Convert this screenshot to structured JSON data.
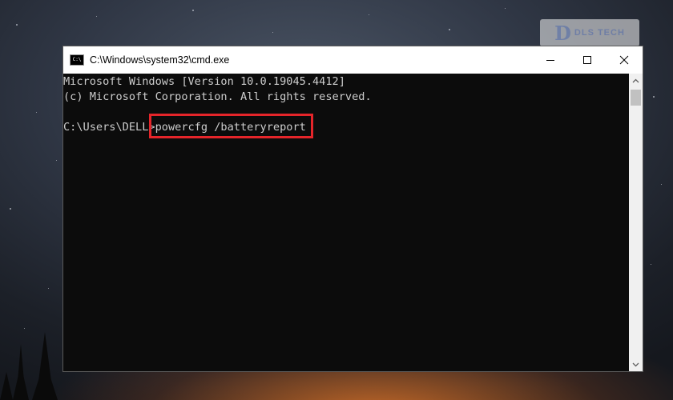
{
  "window": {
    "title": "C:\\Windows\\system32\\cmd.exe",
    "icon_label": "C:\\"
  },
  "console": {
    "line1": "Microsoft Windows [Version 10.0.19045.4412]",
    "line2": "(c) Microsoft Corporation. All rights reserved.",
    "prompt": "C:\\Users\\DELL>",
    "command": "powercfg /batteryreport"
  },
  "watermark": {
    "mark": "D",
    "text": "DLS TECH"
  },
  "colors": {
    "highlight": "#e5252a",
    "console_bg": "#0c0c0c",
    "console_text": "#cccccc"
  },
  "icons": [
    "cmd-app-icon",
    "minimize-icon",
    "maximize-icon",
    "close-icon",
    "scroll-up-arrow-icon",
    "scroll-down-arrow-icon"
  ]
}
